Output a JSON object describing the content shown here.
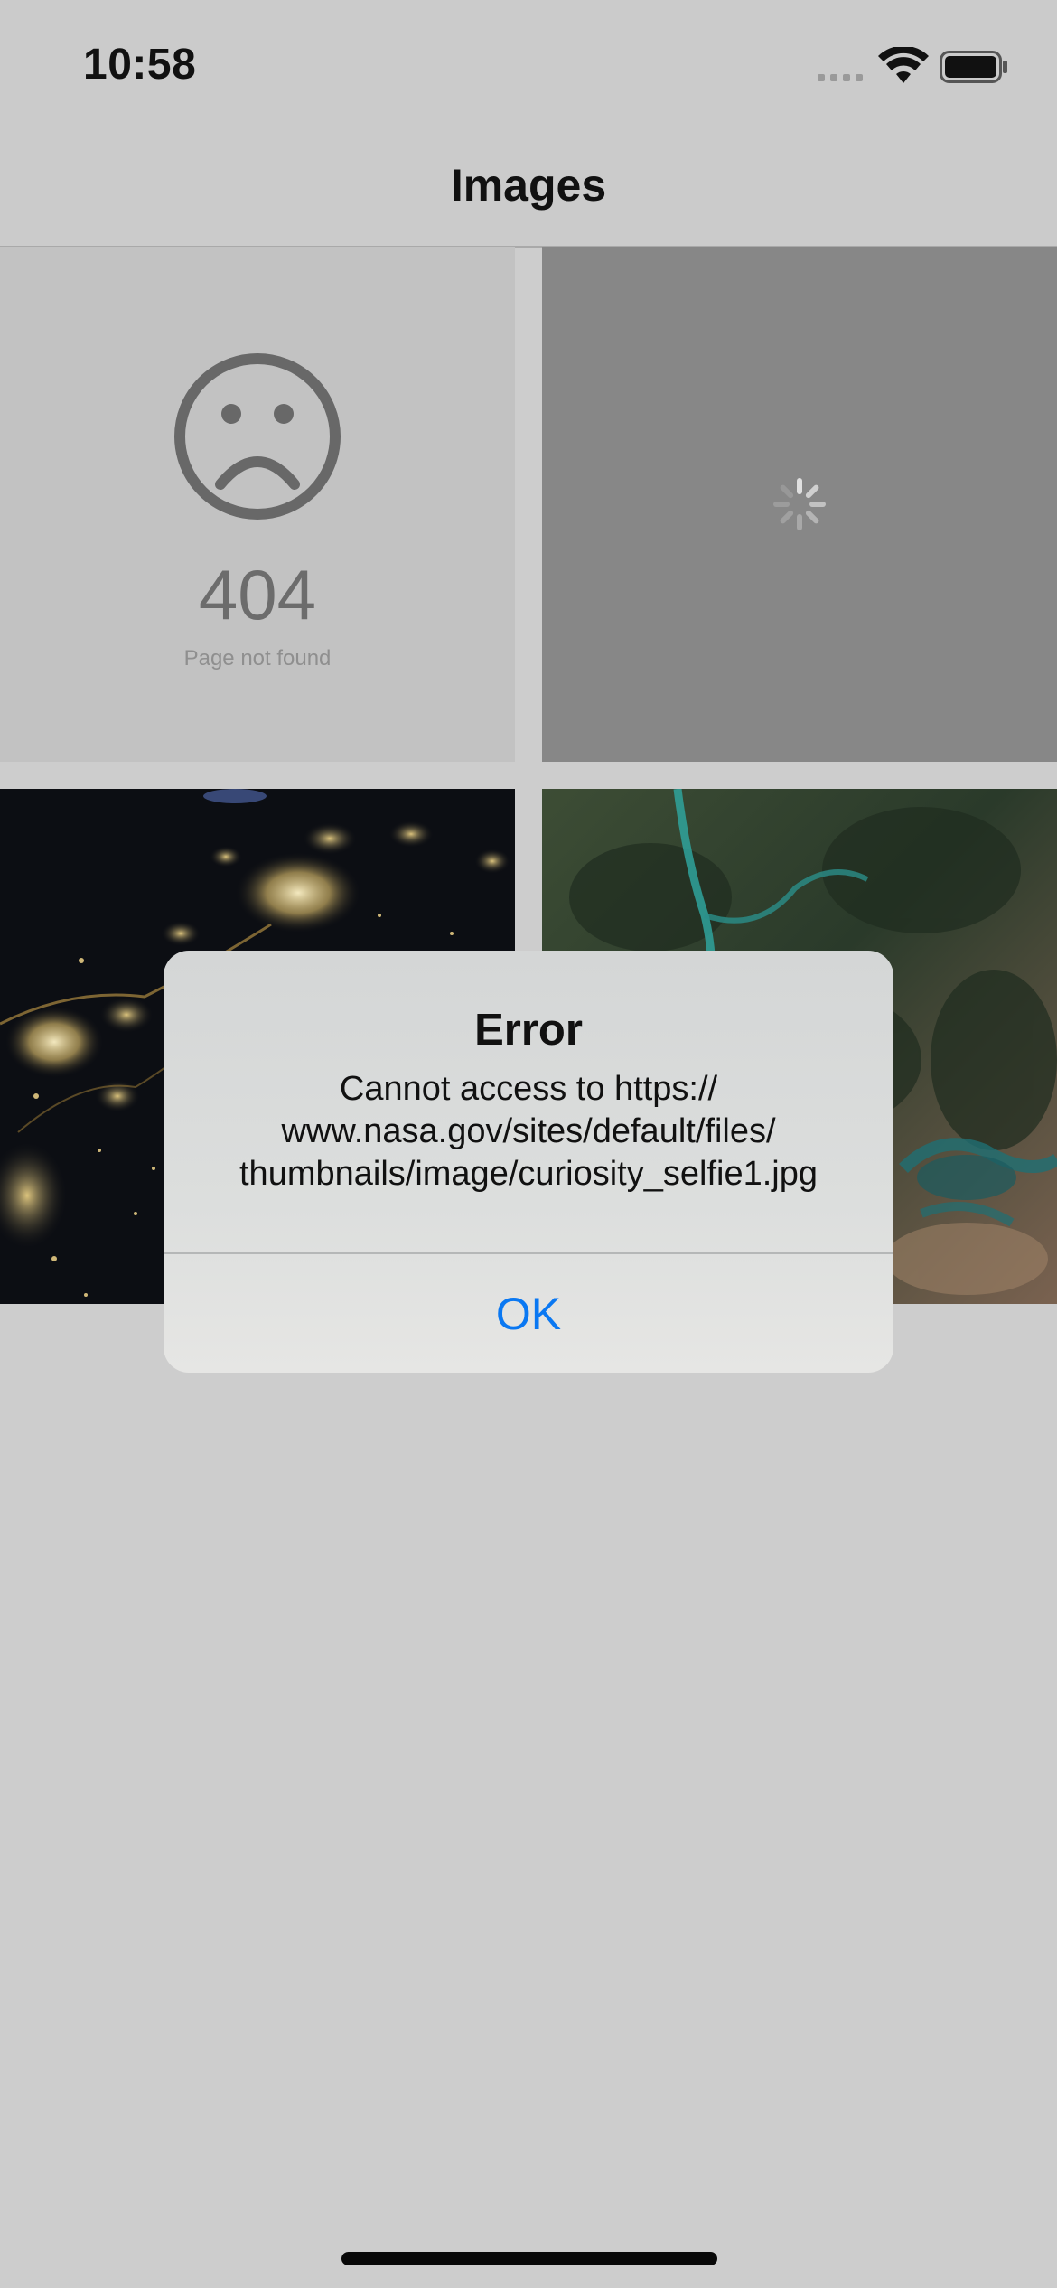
{
  "status_bar": {
    "time": "10:58"
  },
  "nav": {
    "title": "Images"
  },
  "grid": [
    {
      "state": "error",
      "code": "404",
      "message": "Page not found"
    },
    {
      "state": "loading"
    },
    {
      "state": "image",
      "subject": "city lights at night from orbit"
    },
    {
      "state": "image",
      "subject": "forested terrain and lake from orbit"
    }
  ],
  "alert": {
    "title": "Error",
    "message": "Cannot access to https://\nwww.nasa.gov/sites/default/files/\nthumbnails/image/curiosity_selfie1.jpg",
    "ok_label": "OK"
  },
  "colors": {
    "accent": "#0a78f2",
    "background": "#cdcdcd"
  },
  "icons": [
    "signal-icon",
    "wifi-icon",
    "battery-icon",
    "sad-face-icon",
    "spinner-icon"
  ]
}
